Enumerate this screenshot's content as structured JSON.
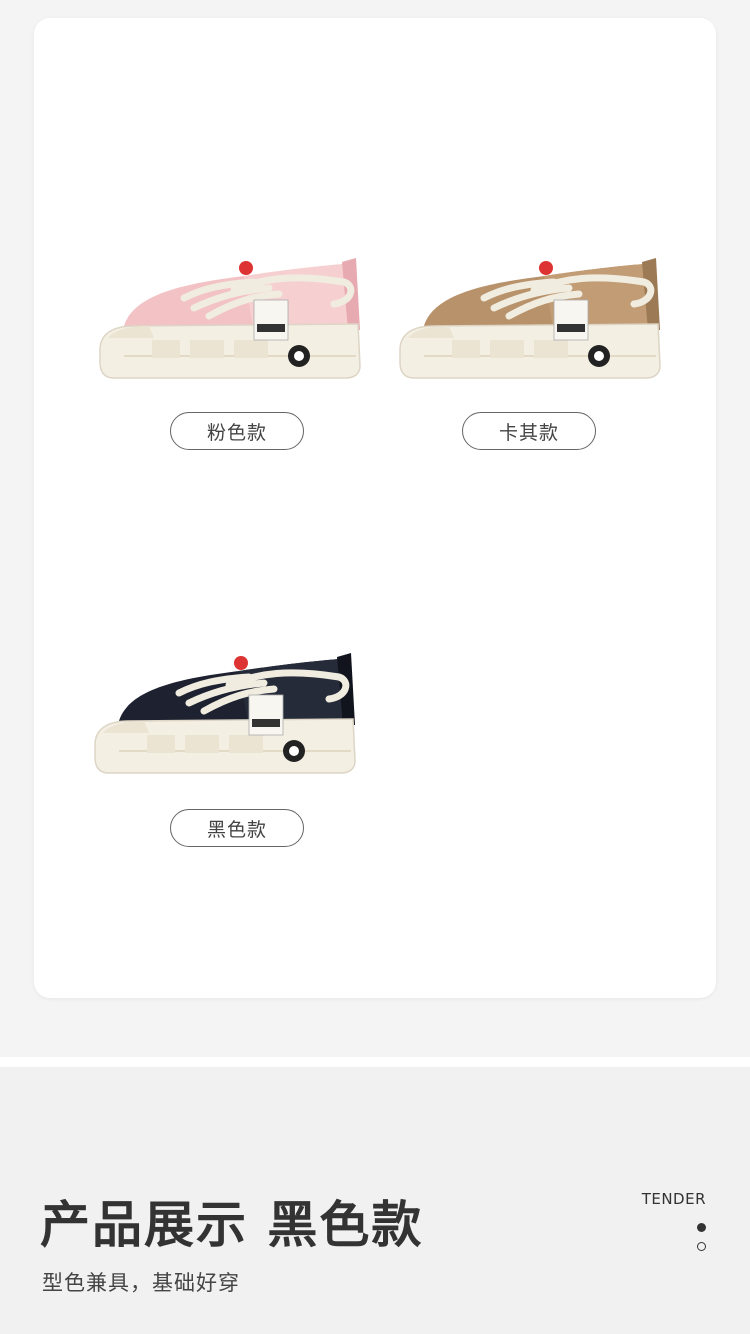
{
  "variants": [
    {
      "label": "粉色款",
      "color": "#f2c2c4",
      "shade": "#e6aab0"
    },
    {
      "label": "卡其款",
      "color": "#b8926a",
      "shade": "#9c7a55"
    },
    {
      "label": "黑色款",
      "color": "#1e2230",
      "shade": "#11141d"
    }
  ],
  "section": {
    "title": "产品展示 黑色款",
    "subtitle": "型色兼具，基础好穿",
    "brand": "TENDER"
  },
  "colors": {
    "sole": "#f4efe3",
    "lace": "#f1ece0",
    "page_background": "#f4f4f4"
  }
}
